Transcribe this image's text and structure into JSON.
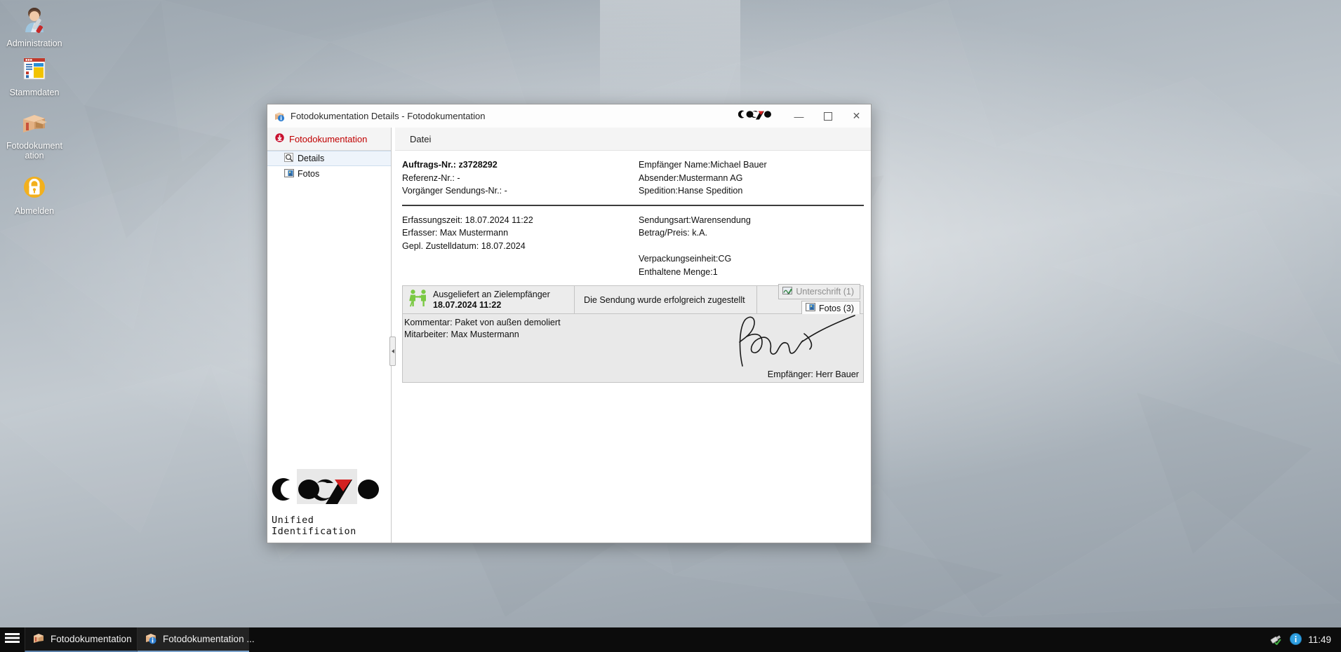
{
  "desktop": {
    "icons": [
      {
        "name": "Administration",
        "icon": "admin-wrench-icon"
      },
      {
        "name": "Stammdaten",
        "icon": "master-data-icon"
      },
      {
        "name": "Fotodokument\nation",
        "icon": "parcel-box-icon"
      },
      {
        "name": "Abmelden",
        "icon": "lock-icon"
      }
    ]
  },
  "window": {
    "title": "Fotodokumentation Details - Fotodokumentation",
    "brand": "cosys",
    "controls": {
      "minimize": "—",
      "maximize": "☐",
      "close": "✕"
    }
  },
  "leftnav": {
    "header": "Fotodokumentation",
    "header_color": "#c00000",
    "items": [
      {
        "label": "Details",
        "icon": "magnifier-icon",
        "selected": true
      },
      {
        "label": "Fotos",
        "icon": "photo-icon",
        "selected": false
      }
    ],
    "logo_text": "cosys",
    "logo_tagline": "Unified Identification"
  },
  "menubar": {
    "items": [
      "Datei"
    ]
  },
  "details": {
    "top_left": [
      {
        "text": "Auftrags-Nr.: z3728292",
        "bold": true
      },
      {
        "text": "Referenz-Nr.: -",
        "bold": false
      },
      {
        "text": "Vorgänger Sendungs-Nr.: -",
        "bold": false
      }
    ],
    "top_right": [
      {
        "text": "Empfänger Name:Michael Bauer",
        "bold": false
      },
      {
        "text": "Absender:Mustermann AG",
        "bold": false
      },
      {
        "text": "Spedition:Hanse Spedition",
        "bold": false
      }
    ],
    "bottom_left": [
      {
        "text": "Erfassungszeit: 18.07.2024 11:22",
        "bold": false
      },
      {
        "text": "Erfasser: Max Mustermann",
        "bold": false
      },
      {
        "text": "Gepl. Zustelldatum: 18.07.2024",
        "bold": false
      }
    ],
    "bottom_right": [
      {
        "text": "Sendungsart:Warensendung",
        "bold": false
      },
      {
        "text": "Betrag/Preis: k.A.",
        "bold": false
      },
      {
        "text": "",
        "bold": false
      },
      {
        "text": "Verpackungseinheit:CG",
        "bold": false
      },
      {
        "text": "Enthaltene Menge:1",
        "bold": false
      }
    ]
  },
  "status": {
    "icon": "handover-people-icon",
    "title": "Ausgeliefert an Zielempfänger",
    "timestamp": "18.07.2024 11:22",
    "message": "Die Sendung wurde erfolgreich zugestellt",
    "tabs": [
      {
        "label": "Unterschrift (1)",
        "icon": "signature-pen-icon",
        "state": "inactive"
      },
      {
        "label": "Fotos (3)",
        "icon": "photo-icon",
        "state": "active"
      }
    ]
  },
  "signature": {
    "comment": "Kommentar: Paket von außen demoliert",
    "employee": "Mitarbeiter: Max Mustermann",
    "caption": "Empfänger: Herr Bauer"
  },
  "taskbar": {
    "start_icon": "menu-hamburger-icon",
    "items": [
      {
        "label": "Fotodokumentation",
        "icon": "parcel-box-icon",
        "active": false
      },
      {
        "label": "Fotodokumentation ...",
        "icon": "parcel-info-icon",
        "active": true
      }
    ],
    "tray": {
      "network_icon": "network-plug-icon",
      "info_icon": "info-circle-icon",
      "clock": "11:49"
    }
  }
}
